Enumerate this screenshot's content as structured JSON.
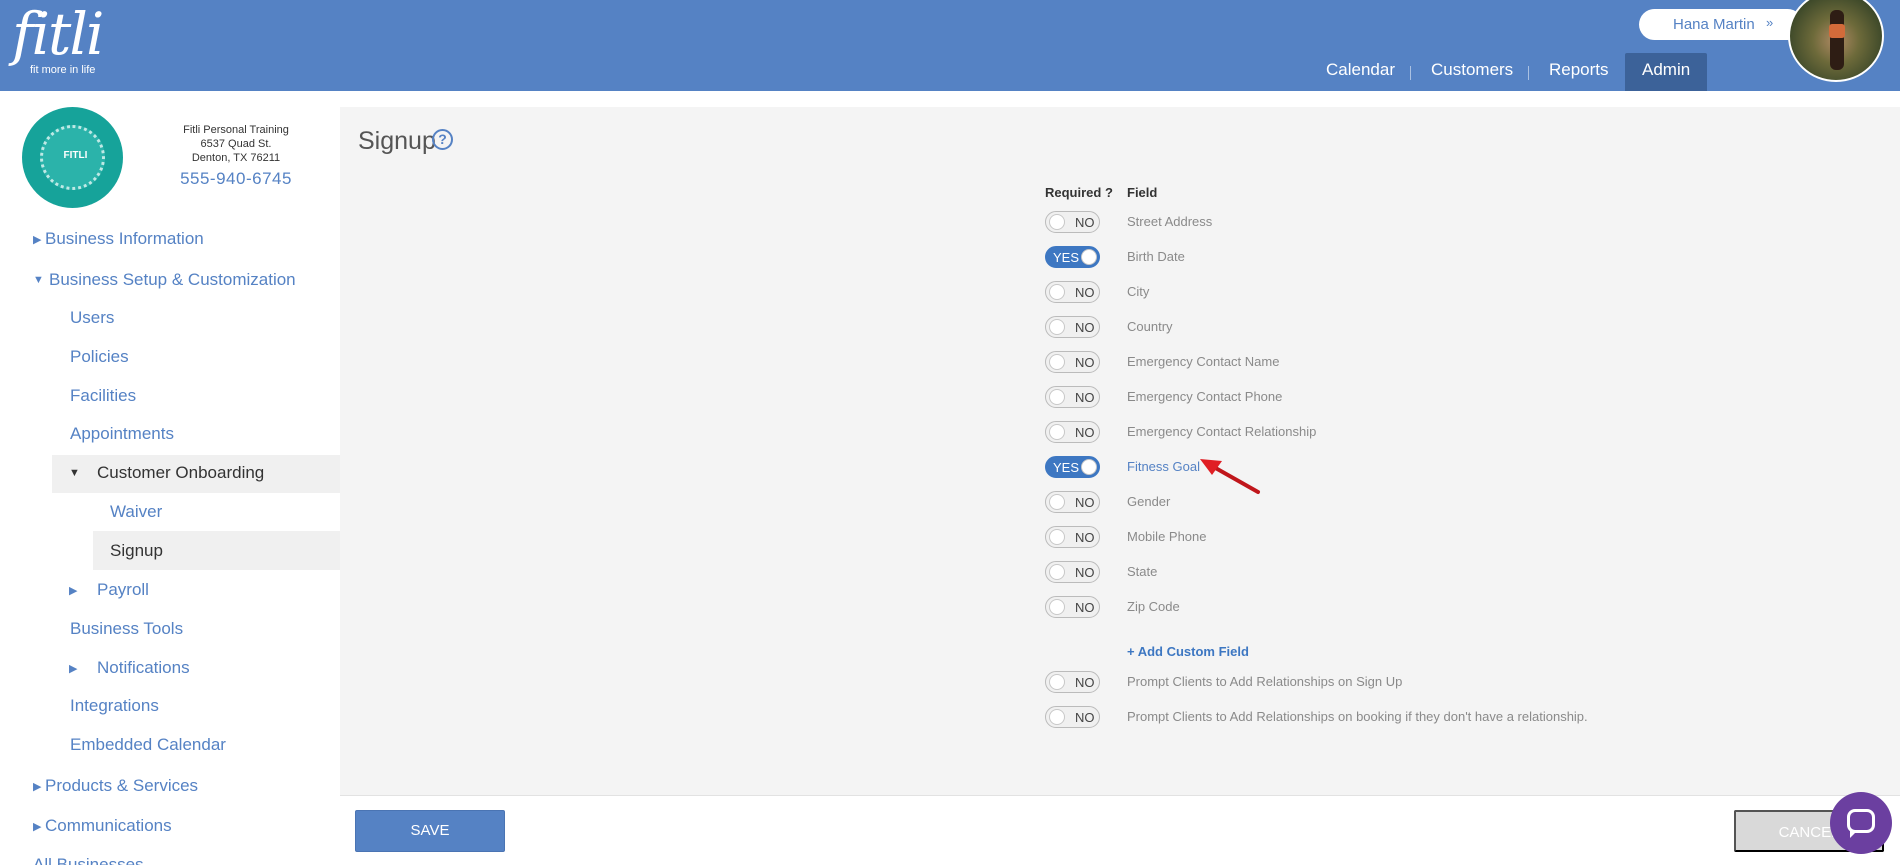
{
  "header": {
    "logo_word": "fitli",
    "logo_tagline": "fit more in life",
    "user_name": "Hana Martin",
    "user_chevron": "»",
    "nav": [
      "Calendar",
      "Customers",
      "Reports",
      "Admin"
    ],
    "active_nav": "Admin",
    "brand_color": "#5582c4"
  },
  "business": {
    "logo_text": "FITLI",
    "name": "Fitli Personal Training",
    "address1": "6537 Quad St.",
    "address2": "Denton, TX 76211",
    "phone": "555-940-6745"
  },
  "sidebar": {
    "business_information": "Business Information",
    "business_setup": "Business Setup & Customization",
    "users": "Users",
    "policies": "Policies",
    "facilities": "Facilities",
    "appointments": "Appointments",
    "customer_onboarding": "Customer Onboarding",
    "waiver": "Waiver",
    "signup": "Signup",
    "payroll": "Payroll",
    "business_tools": "Business Tools",
    "notifications": "Notifications",
    "integrations": "Integrations",
    "embedded_calendar": "Embedded Calendar",
    "products_services": "Products & Services",
    "communications": "Communications",
    "all_businesses": "All Businesses"
  },
  "page": {
    "title": "Signup",
    "help_icon": "?",
    "col_required": "Required ?",
    "col_field": "Field",
    "fields": [
      {
        "state": "NO",
        "label": "Street Address"
      },
      {
        "state": "YES",
        "label": "Birth Date"
      },
      {
        "state": "NO",
        "label": "City"
      },
      {
        "state": "NO",
        "label": "Country"
      },
      {
        "state": "NO",
        "label": "Emergency Contact Name"
      },
      {
        "state": "NO",
        "label": "Emergency Contact Phone"
      },
      {
        "state": "NO",
        "label": "Emergency Contact Relationship"
      },
      {
        "state": "YES",
        "label": "Fitness Goal"
      },
      {
        "state": "NO",
        "label": "Gender"
      },
      {
        "state": "NO",
        "label": "Mobile Phone"
      },
      {
        "state": "NO",
        "label": "State"
      },
      {
        "state": "NO",
        "label": "Zip Code"
      }
    ],
    "add_custom_field": "+ Add Custom Field",
    "prompts": [
      {
        "state": "NO",
        "label": "Prompt Clients to Add Relationships on Sign Up"
      },
      {
        "state": "NO",
        "label": "Prompt Clients to Add Relationships on booking if they don't have a relationship."
      }
    ]
  },
  "footer": {
    "save": "SAVE",
    "cancel": "CANCEL"
  }
}
